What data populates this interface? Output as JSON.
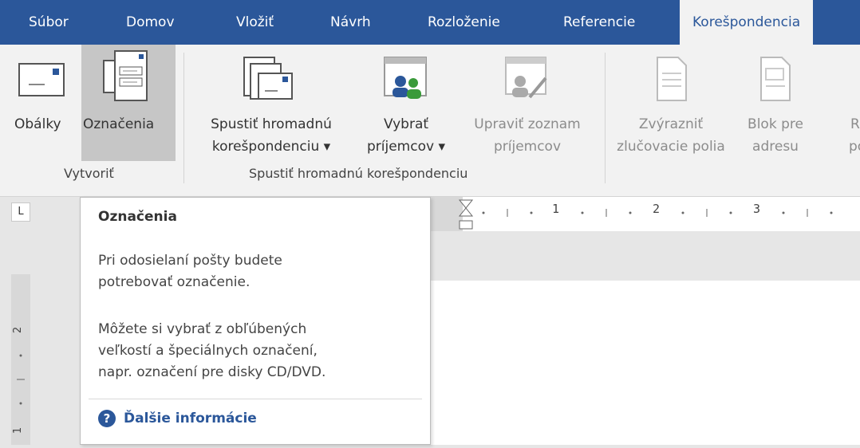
{
  "tabs": [
    "Súbor",
    "Domov",
    "Vložiť",
    "Návrh",
    "Rozloženie",
    "Referencie",
    "Korešpondencia"
  ],
  "ribbon": {
    "envelopes": "Obálky",
    "labels": "Označenia",
    "start_merge_line1": "Spustiť hromadnú",
    "start_merge_line2": "korešpondenciu ▾",
    "select_recipients_line1": "Vybrať",
    "select_recipients_line2": "príjemcov ▾",
    "edit_list_line1": "Upraviť zoznam",
    "edit_list_line2": "príjemcov",
    "highlight_line1": "Zvýrazniť",
    "highlight_line2": "zlučovacie polia",
    "address_block_line1": "Blok pre",
    "address_block_line2": "adresu",
    "cut_line1": "R",
    "cut_line2": "po",
    "group_create": "Vytvoriť",
    "group_start_merge": "Spustiť hromadnú korešpondenciu"
  },
  "ruler": {
    "corner": "L",
    "n1": "1",
    "n2": "2",
    "n3": "3"
  },
  "tooltip": {
    "title": "Označenia",
    "para1_line1": "Pri odosielaní pošty budete",
    "para1_line2": "potrebovať označenie.",
    "para2_line1": "Môžete si vybrať z obľúbených",
    "para2_line2": "veľkostí a špeciálnych označení,",
    "para2_line3": "napr. označení pre disky CD/DVD.",
    "link": "Ďalšie informácie"
  }
}
